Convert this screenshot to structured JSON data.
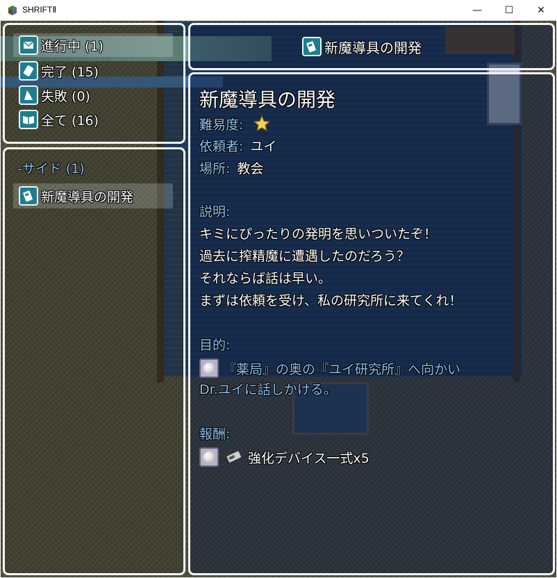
{
  "window": {
    "title": "SHRIFTⅡ"
  },
  "window_controls": {
    "minimize": "—",
    "maximize": "☐",
    "close": "✕"
  },
  "status_menu": [
    {
      "label": "進行中 (1)",
      "icon": "envelope-icon",
      "selected": true
    },
    {
      "label": "完了 (15)",
      "icon": "scroll-icon",
      "selected": false
    },
    {
      "label": "失敗 (0)",
      "icon": "broken-icon",
      "selected": false
    },
    {
      "label": "全て (16)",
      "icon": "book-icon",
      "selected": false
    }
  ],
  "quest_list": {
    "category": "-サイド (1)",
    "items": [
      {
        "label": "新魔導具の開発",
        "icon": "quest-device-icon"
      }
    ]
  },
  "header": {
    "title": "新魔導具の開発",
    "icon": "quest-device-icon"
  },
  "detail": {
    "title": "新魔導具の開発",
    "difficulty_label": "難易度:",
    "difficulty_stars": 1,
    "client_label": "依頼者:",
    "client": "ユイ",
    "location_label": "場所:",
    "location": "教会",
    "description_label": "説明:",
    "description": [
      "キミにぴったりの発明を思いついたぞ！",
      "過去に搾精魔に遭遇したのだろう？",
      "それならば話は早い。",
      "まずは依頼を受け、私の研究所に来てくれ！"
    ],
    "objective_label": "目的:",
    "objective": [
      "『薬局』の奥の『ユイ研究所』へ向かい",
      "Dr.ユイに話しかける。"
    ],
    "reward_label": "報酬:",
    "reward": "強化デバイス一式x5"
  },
  "colors": {
    "system_text": "#8ec1ec",
    "panel_border": "#f4f4f4",
    "icon_teal": "#1f7e8e"
  }
}
